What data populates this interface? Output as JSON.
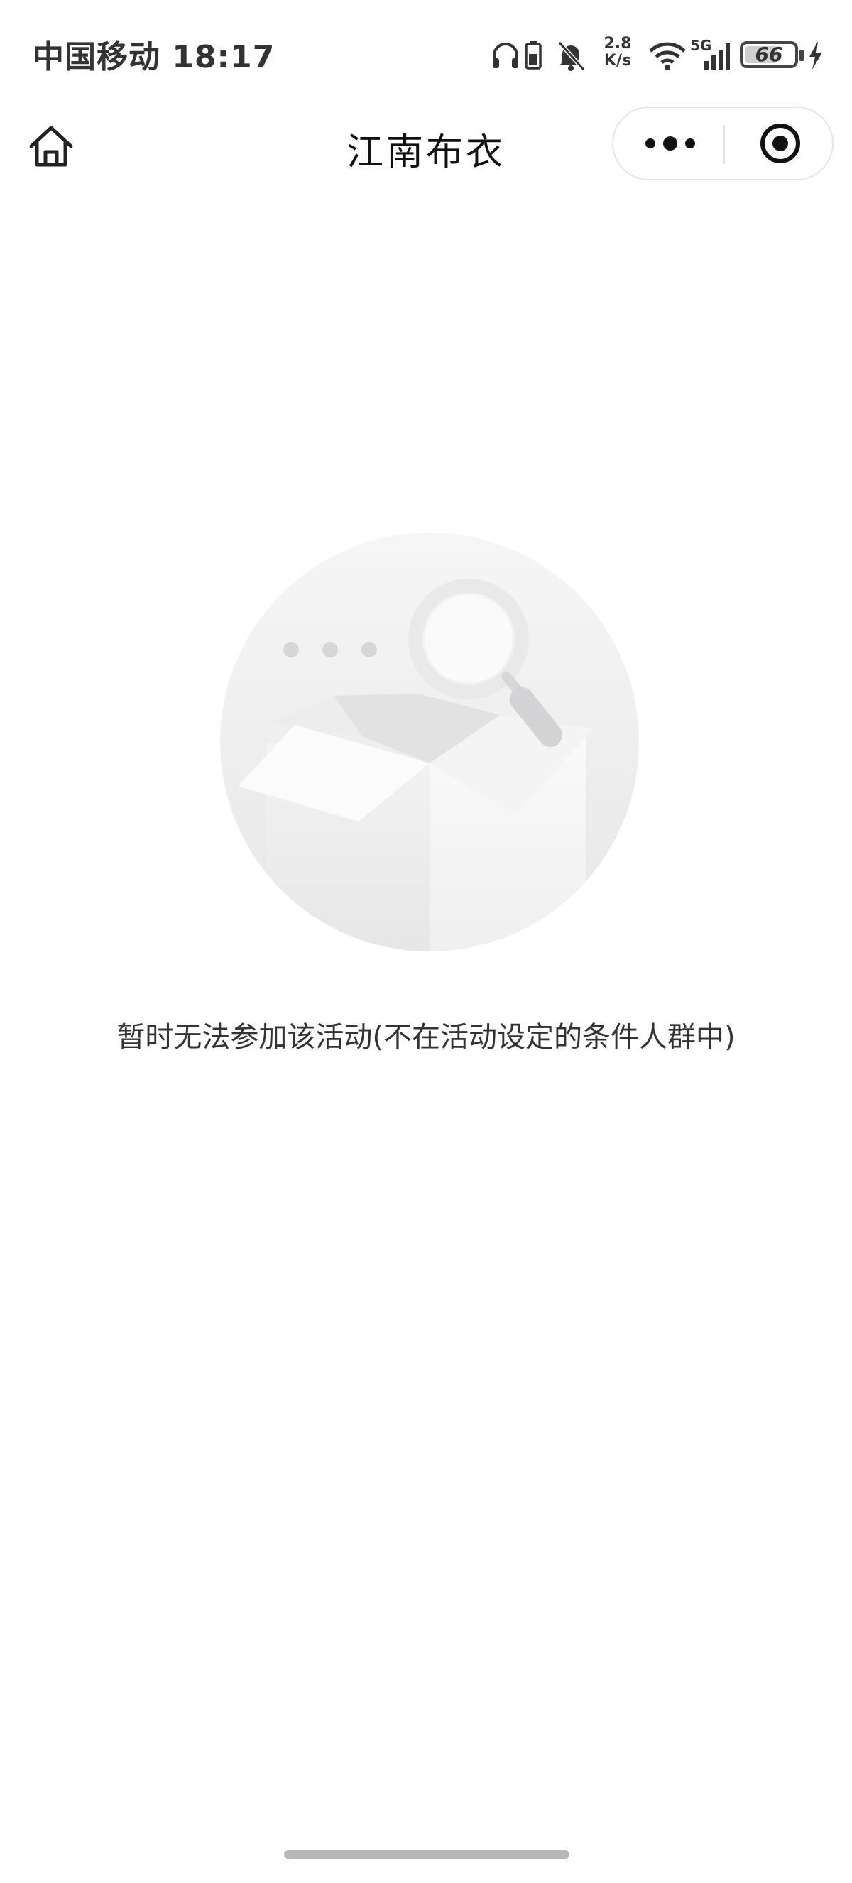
{
  "status_bar": {
    "carrier_time": "中国移动 18:17",
    "net_speed_value": "2.8",
    "net_speed_unit": "K/s",
    "network_type": "5G",
    "battery_level": "66",
    "icons": [
      "headphones-icon",
      "battery-small-icon",
      "bell-muted-icon",
      "wifi-icon",
      "signal-icon",
      "charging-icon"
    ]
  },
  "nav": {
    "title": "江南布衣",
    "home_icon": "home-icon",
    "more_icon": "more-dots-icon",
    "close_icon": "target-close-icon"
  },
  "empty_state": {
    "illustration_icon": "empty-box-search-icon",
    "message": "暂时无法参加该活动(不在活动设定的条件人群中)"
  },
  "colors": {
    "background": "#ffffff",
    "text_primary": "#222222",
    "illustration_gray": "#eeeeee"
  }
}
